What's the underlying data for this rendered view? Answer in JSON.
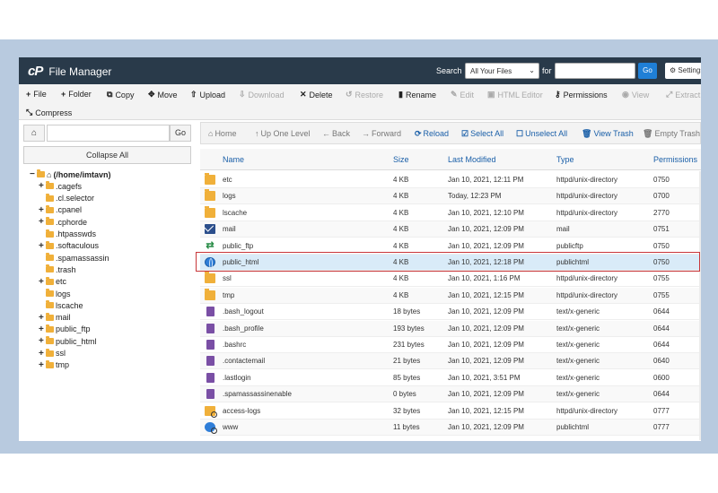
{
  "app": {
    "logo": "cP",
    "title": "File Manager"
  },
  "search": {
    "label": "Search",
    "scope": "All Your Files",
    "for_label": "for",
    "go": "Go",
    "settings": "Settings"
  },
  "toolbar": {
    "file": "File",
    "folder": "Folder",
    "copy": "Copy",
    "move": "Move",
    "upload": "Upload",
    "download": "Download",
    "delete": "Delete",
    "restore": "Restore",
    "rename": "Rename",
    "edit": "Edit",
    "html_editor": "HTML Editor",
    "permissions": "Permissions",
    "view": "View",
    "extract": "Extract",
    "compress": "Compress"
  },
  "left": {
    "go": "Go",
    "collapse_all": "Collapse All",
    "tree": [
      {
        "toggle": "−",
        "label": "(/home/imtavn)"
      },
      {
        "toggle": "+",
        "label": ".cagefs"
      },
      {
        "toggle": "",
        "label": ".cl.selector"
      },
      {
        "toggle": "+",
        "label": ".cpanel"
      },
      {
        "toggle": "+",
        "label": ".cphorde"
      },
      {
        "toggle": "",
        "label": ".htpasswds"
      },
      {
        "toggle": "+",
        "label": ".softaculous"
      },
      {
        "toggle": "",
        "label": ".spamassassin"
      },
      {
        "toggle": "",
        "label": ".trash"
      },
      {
        "toggle": "+",
        "label": "etc"
      },
      {
        "toggle": "",
        "label": "logs"
      },
      {
        "toggle": "",
        "label": "lscache"
      },
      {
        "toggle": "+",
        "label": "mail"
      },
      {
        "toggle": "+",
        "label": "public_ftp"
      },
      {
        "toggle": "+",
        "label": "public_html"
      },
      {
        "toggle": "+",
        "label": "ssl"
      },
      {
        "toggle": "+",
        "label": "tmp"
      }
    ]
  },
  "nav": {
    "home": "Home",
    "up_one_level": "Up One Level",
    "back": "Back",
    "forward": "Forward",
    "reload": "Reload",
    "select_all": "Select All",
    "unselect_all": "Unselect All",
    "view_trash": "View Trash",
    "empty_trash": "Empty Trash"
  },
  "columns": {
    "name": "Name",
    "size": "Size",
    "last_modified": "Last Modified",
    "type": "Type",
    "permissions": "Permissions"
  },
  "files": [
    {
      "icon": "folder",
      "name": "etc",
      "size": "4 KB",
      "modified": "Jan 10, 2021, 12:11 PM",
      "type": "httpd/unix-directory",
      "perms": "0750"
    },
    {
      "icon": "folder",
      "name": "logs",
      "size": "4 KB",
      "modified": "Today, 12:23 PM",
      "type": "httpd/unix-directory",
      "perms": "0700"
    },
    {
      "icon": "folder",
      "name": "lscache",
      "size": "4 KB",
      "modified": "Jan 10, 2021, 12:10 PM",
      "type": "httpd/unix-directory",
      "perms": "2770"
    },
    {
      "icon": "mail",
      "name": "mail",
      "size": "4 KB",
      "modified": "Jan 10, 2021, 12:09 PM",
      "type": "mail",
      "perms": "0751"
    },
    {
      "icon": "ftp",
      "name": "public_ftp",
      "size": "4 KB",
      "modified": "Jan 10, 2021, 12:09 PM",
      "type": "publicftp",
      "perms": "0750"
    },
    {
      "icon": "globe",
      "name": "public_html",
      "size": "4 KB",
      "modified": "Jan 10, 2021, 12:18 PM",
      "type": "publichtml",
      "perms": "0750",
      "selected": true
    },
    {
      "icon": "folder",
      "name": "ssl",
      "size": "4 KB",
      "modified": "Jan 10, 2021, 1:16 PM",
      "type": "httpd/unix-directory",
      "perms": "0755"
    },
    {
      "icon": "folder",
      "name": "tmp",
      "size": "4 KB",
      "modified": "Jan 10, 2021, 12:15 PM",
      "type": "httpd/unix-directory",
      "perms": "0755"
    },
    {
      "icon": "file",
      "name": ".bash_logout",
      "size": "18 bytes",
      "modified": "Jan 10, 2021, 12:09 PM",
      "type": "text/x-generic",
      "perms": "0644"
    },
    {
      "icon": "file",
      "name": ".bash_profile",
      "size": "193 bytes",
      "modified": "Jan 10, 2021, 12:09 PM",
      "type": "text/x-generic",
      "perms": "0644"
    },
    {
      "icon": "file",
      "name": ".bashrc",
      "size": "231 bytes",
      "modified": "Jan 10, 2021, 12:09 PM",
      "type": "text/x-generic",
      "perms": "0644"
    },
    {
      "icon": "file",
      "name": ".contactemail",
      "size": "21 bytes",
      "modified": "Jan 10, 2021, 12:09 PM",
      "type": "text/x-generic",
      "perms": "0640"
    },
    {
      "icon": "file",
      "name": ".lastlogin",
      "size": "85 bytes",
      "modified": "Jan 10, 2021, 3:51 PM",
      "type": "text/x-generic",
      "perms": "0600"
    },
    {
      "icon": "file",
      "name": ".spamassassinenable",
      "size": "0 bytes",
      "modified": "Jan 10, 2021, 12:09 PM",
      "type": "text/x-generic",
      "perms": "0644"
    },
    {
      "icon": "folder-link",
      "name": "access-logs",
      "size": "32 bytes",
      "modified": "Jan 10, 2021, 12:15 PM",
      "type": "httpd/unix-directory",
      "perms": "0777"
    },
    {
      "icon": "globe-link",
      "name": "www",
      "size": "11 bytes",
      "modified": "Jan 10, 2021, 12:09 PM",
      "type": "publichtml",
      "perms": "0777"
    }
  ],
  "colors": {
    "topbar": "#293a4a",
    "accent": "#1f7fd6",
    "selection_border": "#c8363a",
    "selected_row": "#d9ebf8",
    "frame": "#b8cadf"
  }
}
